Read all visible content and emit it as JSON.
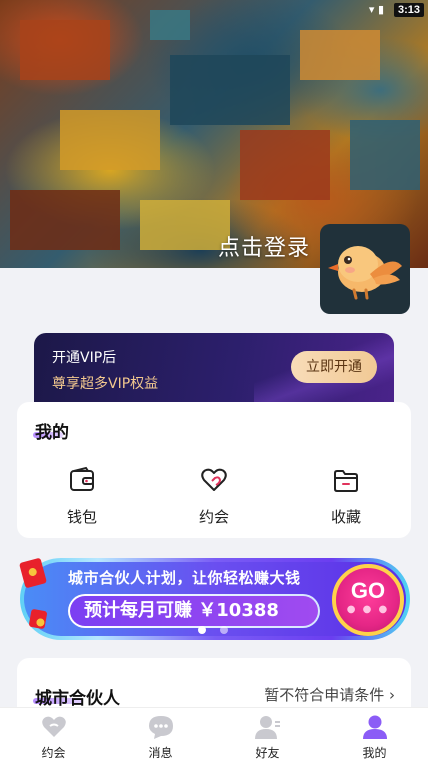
{
  "status_bar": {
    "time": "3:13"
  },
  "header": {
    "login_text": "点击登录"
  },
  "vip": {
    "title": "开通VIP后",
    "subtitle": "尊享超多VIP权益",
    "button_label": "立即开通"
  },
  "my_section": {
    "title": "我的",
    "items": [
      {
        "label": "钱包",
        "icon": "wallet-icon"
      },
      {
        "label": "约会",
        "icon": "heart-icon"
      },
      {
        "label": "收藏",
        "icon": "folder-icon"
      }
    ]
  },
  "partner_banner": {
    "line1": "城市合伙人计划，让你轻松赚大钱",
    "line2": "预计每月可赚 ￥10388",
    "go_label": "GO",
    "carousel_index": 1,
    "carousel_count": 2
  },
  "city_partner": {
    "title": "城市合伙人",
    "status": "暂不符合申请条件"
  },
  "tabbar": {
    "items": [
      {
        "label": "约会",
        "icon": "heart-icon",
        "active": false
      },
      {
        "label": "消息",
        "icon": "chat-icon",
        "active": false
      },
      {
        "label": "好友",
        "icon": "contacts-icon",
        "active": false
      },
      {
        "label": "我的",
        "icon": "profile-icon",
        "active": true
      }
    ]
  },
  "colors": {
    "accent": "#8b5cf6",
    "vip_gold": "#f3c98f",
    "inactive_icon": "#c9c9cf"
  }
}
